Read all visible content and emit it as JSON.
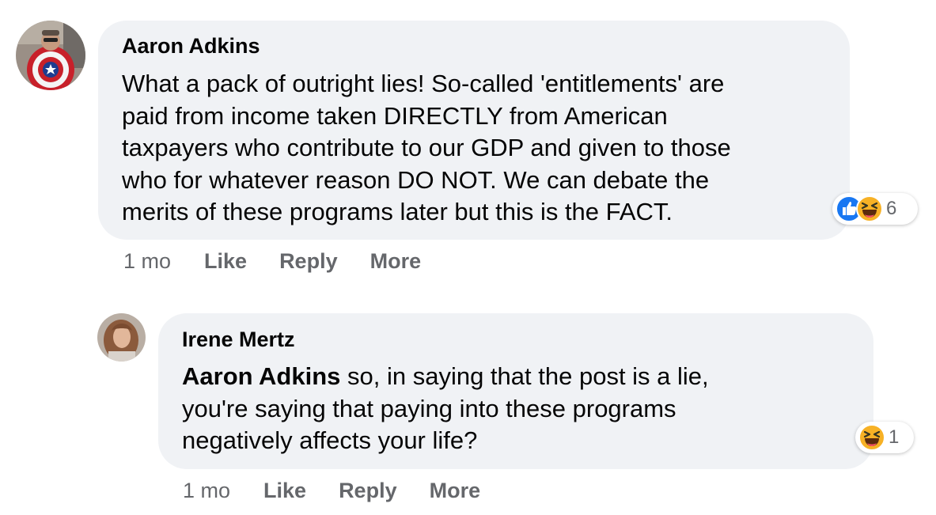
{
  "comments": [
    {
      "author": "Aaron Adkins",
      "lines": [
        "What a pack of outright lies! So-called 'entitlements' are",
        "paid from income taken DIRECTLY from American",
        "taxpayers who contribute to our GDP and given to those",
        "who for whatever reason DO NOT. We can debate the",
        "merits of these programs later but this is the FACT."
      ],
      "reactions": {
        "icons": [
          "like-icon",
          "haha-icon"
        ],
        "count": "6"
      },
      "time": "1 mo",
      "like_label": "Like",
      "reply_label": "Reply",
      "more_label": "More"
    },
    {
      "author": "Irene Mertz",
      "mention": "Aaron Adkins",
      "first_line_rest": " so, in saying that the post is a lie,",
      "lines": [
        "you're saying that paying into these programs",
        "negatively affects your life?"
      ],
      "reactions": {
        "icons": [
          "haha-icon"
        ],
        "count": "1"
      },
      "time": "1 mo",
      "like_label": "Like",
      "reply_label": "Reply",
      "more_label": "More"
    }
  ],
  "colors": {
    "bubble": "#f0f2f5",
    "secondary_text": "#65676b",
    "like_blue": "#1877f2",
    "haha_yellow": "#f7b125"
  }
}
